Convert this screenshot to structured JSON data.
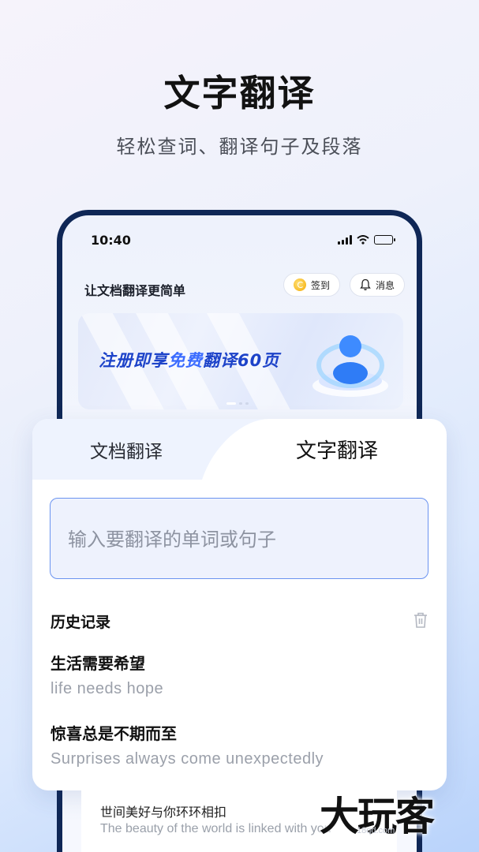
{
  "hero": {
    "title": "文字翻译",
    "subtitle": "轻松查词、翻译句子及段落"
  },
  "status_bar": {
    "time": "10:40"
  },
  "app": {
    "title": "让文档翻译更简单",
    "checkin_label": "签到",
    "message_label": "消息"
  },
  "banner": {
    "text_prefix": "注册即享",
    "text_highlight": "免费",
    "text_suffix": "翻译60页"
  },
  "tabs": [
    {
      "label": "文档翻译",
      "active": false
    },
    {
      "label": "文字翻译",
      "active": true
    }
  ],
  "input": {
    "placeholder": "输入要翻译的单词或句子",
    "value": ""
  },
  "history": {
    "label": "历史记录",
    "items": [
      {
        "source": "生活需要希望",
        "translation": "life needs hope"
      },
      {
        "source": "惊喜总是不期而至",
        "translation": "Surprises always come unexpectedly"
      },
      {
        "source": "世间美好与你环环相扣",
        "translation": "The beauty of the world is linked with you"
      }
    ]
  },
  "watermark": {
    "text": "大玩客",
    "url": "18qd.com"
  },
  "colors": {
    "accent": "#6a93f0",
    "banner_text": "#1d43c9",
    "phone_frame": "#0f2756"
  }
}
